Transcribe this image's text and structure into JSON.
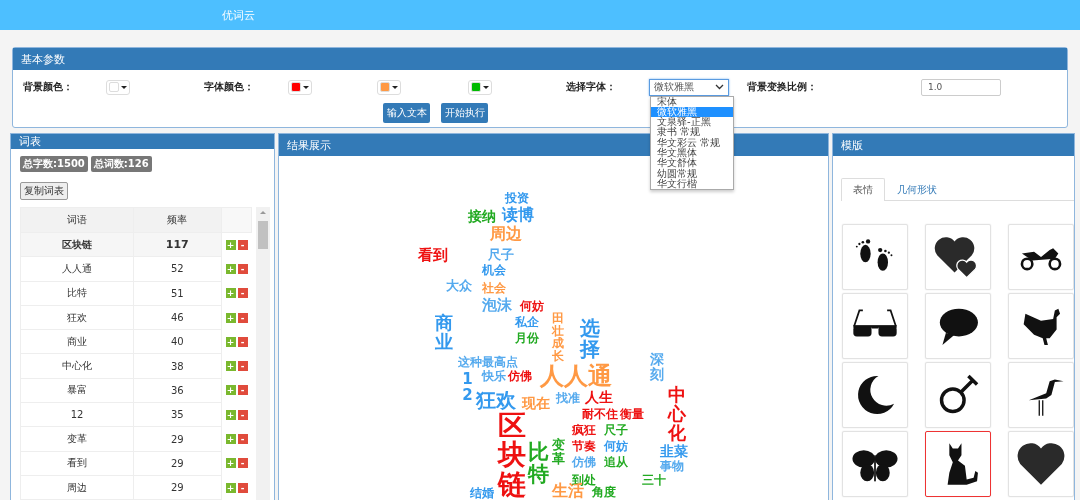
{
  "app": {
    "title": "优词云"
  },
  "params": {
    "title": "基本参数",
    "background_label": "背景颜色：",
    "background_swatch": {
      "color": "#ffffff"
    },
    "font_color_label": "字体颜色：",
    "font_colors": [
      {
        "color": "#ff0000"
      },
      {
        "color": "#ff9944"
      },
      {
        "color": "#00bb00"
      }
    ],
    "font_select": {
      "label": "选择字体：",
      "value": "微软雅黑",
      "expanded": true,
      "options": [
        {
          "label": "宋体",
          "selected": false
        },
        {
          "label": "微软雅黑",
          "selected": true
        },
        {
          "label": "文泉驿-正黑",
          "selected": false
        },
        {
          "label": "隶书 常规",
          "selected": false
        },
        {
          "label": "华文彩云 常规",
          "selected": false
        },
        {
          "label": "华文黑体",
          "selected": false
        },
        {
          "label": "华文舒体",
          "selected": false
        },
        {
          "label": "幼圆常规",
          "selected": false
        },
        {
          "label": "华文行楷",
          "selected": false
        }
      ]
    },
    "ratio": {
      "label": "背景变换比例：",
      "value": "1.0"
    },
    "buttons": [
      "输入文本",
      "开始执行"
    ]
  },
  "word_table": {
    "title": "词表",
    "badges": [
      "总字数:1500",
      "总词数:126"
    ],
    "copy_button": "复制词表",
    "columns": [
      "词语",
      "频率"
    ],
    "rows": [
      {
        "word": "区块链",
        "count": "117",
        "selected": true,
        "add": "+",
        "remove": "-"
      },
      {
        "word": "人人通",
        "count": "52",
        "selected": false,
        "add": "+",
        "remove": "-"
      },
      {
        "word": "比特",
        "count": "51",
        "selected": false,
        "add": "+",
        "remove": "-"
      },
      {
        "word": "狂欢",
        "count": "46",
        "selected": false,
        "add": "+",
        "remove": "-"
      },
      {
        "word": "商业",
        "count": "40",
        "selected": false,
        "add": "+",
        "remove": "-"
      },
      {
        "word": "中心化",
        "count": "38",
        "selected": false,
        "add": "+",
        "remove": "-"
      },
      {
        "word": "暴富",
        "count": "36",
        "selected": false,
        "add": "+",
        "remove": "-"
      },
      {
        "word": "12",
        "count": "35",
        "selected": false,
        "add": "+",
        "remove": "-"
      },
      {
        "word": "变革",
        "count": "29",
        "selected": false,
        "add": "+",
        "remove": "-"
      },
      {
        "word": "看到",
        "count": "29",
        "selected": false,
        "add": "+",
        "remove": "-"
      },
      {
        "word": "周边",
        "count": "29",
        "selected": false,
        "add": "+",
        "remove": "-"
      }
    ]
  },
  "result": {
    "title": "结果展示",
    "words": [
      {
        "text": "投资",
        "color": "#3399ee",
        "vertical": false
      },
      {
        "text": "接纳",
        "color": "#22aa22",
        "vertical": false
      },
      {
        "text": "读博",
        "color": "#3399ee",
        "vertical": false
      },
      {
        "text": "周边",
        "color": "#ff9944",
        "vertical": false
      },
      {
        "text": "看到",
        "color": "#ee1111",
        "vertical": false
      },
      {
        "text": "尺子",
        "color": "#55aaee",
        "vertical": false
      },
      {
        "text": "机会",
        "color": "#3399ee",
        "vertical": false
      },
      {
        "text": "大众",
        "color": "#55aaee",
        "vertical": false
      },
      {
        "text": "社会",
        "color": "#ff9944",
        "vertical": false
      },
      {
        "text": "泡沫",
        "color": "#55aaee",
        "vertical": false
      },
      {
        "text": "何妨",
        "color": "#ee1111",
        "vertical": false
      },
      {
        "text": "商业",
        "color": "#3399ee",
        "vertical": true
      },
      {
        "text": "私企",
        "color": "#3399ee",
        "vertical": false
      },
      {
        "text": "月份",
        "color": "#22aa22",
        "vertical": false
      },
      {
        "text": "这种最高点",
        "color": "#55aaee",
        "vertical": false
      },
      {
        "text": "田壮成长",
        "color": "#ff9944",
        "vertical": true
      },
      {
        "text": "选择",
        "color": "#3399ee",
        "vertical": true
      },
      {
        "text": "12",
        "color": "#3399ee",
        "vertical": true
      },
      {
        "text": "快乐",
        "color": "#55aaee",
        "vertical": false
      },
      {
        "text": "仿佛",
        "color": "#ee1111",
        "vertical": false
      },
      {
        "text": "人人通",
        "color": "#ff9944",
        "vertical": false
      },
      {
        "text": "深刻",
        "color": "#55aaee",
        "vertical": true
      },
      {
        "text": "狂欢",
        "color": "#3399ee",
        "vertical": false
      },
      {
        "text": "现在",
        "color": "#ff9944",
        "vertical": false
      },
      {
        "text": "找准",
        "color": "#55aaee",
        "vertical": false
      },
      {
        "text": "人生",
        "color": "#ee1111",
        "vertical": false
      },
      {
        "text": "区块链",
        "color": "#ee1111",
        "vertical": true
      },
      {
        "text": "耐不住",
        "color": "#ee1111",
        "vertical": false
      },
      {
        "text": "衡量",
        "color": "#ee1111",
        "vertical": false
      },
      {
        "text": "中心化",
        "color": "#ee1111",
        "vertical": true
      },
      {
        "text": "韭菜",
        "color": "#3399ee",
        "vertical": false
      },
      {
        "text": "疯狂",
        "color": "#ee1111",
        "vertical": false
      },
      {
        "text": "尺子",
        "color": "#22aa22",
        "vertical": false
      },
      {
        "text": "比特",
        "color": "#22aa22",
        "vertical": true
      },
      {
        "text": "变革",
        "color": "#22aa22",
        "vertical": true
      },
      {
        "text": "节奏",
        "color": "#ee1111",
        "vertical": false
      },
      {
        "text": "何妨",
        "color": "#3399ee",
        "vertical": false
      },
      {
        "text": "仿佛",
        "color": "#55aaee",
        "vertical": false
      },
      {
        "text": "追从",
        "color": "#22aa22",
        "vertical": false
      },
      {
        "text": "事物",
        "color": "#55aaee",
        "vertical": false
      },
      {
        "text": "到处",
        "color": "#22aa22",
        "vertical": false
      },
      {
        "text": "三十",
        "color": "#22aa22",
        "vertical": false
      },
      {
        "text": "结婚",
        "color": "#3399ee",
        "vertical": false
      },
      {
        "text": "生活",
        "color": "#ff9944",
        "vertical": false
      },
      {
        "text": "角度",
        "color": "#22aa22",
        "vertical": false
      }
    ]
  },
  "templates": {
    "title": "模版",
    "tabs": [
      {
        "label": "表情",
        "selected": true
      },
      {
        "label": "几何形状",
        "selected": false
      }
    ],
    "shapes": [
      {
        "kind": "footprints",
        "selected": false
      },
      {
        "kind": "hearts",
        "selected": false
      },
      {
        "kind": "motorcycle",
        "selected": false
      },
      {
        "kind": "sunglasses",
        "selected": false
      },
      {
        "kind": "speech",
        "selected": false
      },
      {
        "kind": "rooster",
        "selected": false
      },
      {
        "kind": "moon",
        "selected": false
      },
      {
        "kind": "gender",
        "selected": false
      },
      {
        "kind": "heron",
        "selected": false
      },
      {
        "kind": "butterfly",
        "selected": false
      },
      {
        "kind": "cat",
        "selected": true
      },
      {
        "kind": "heart",
        "selected": false
      }
    ]
  }
}
